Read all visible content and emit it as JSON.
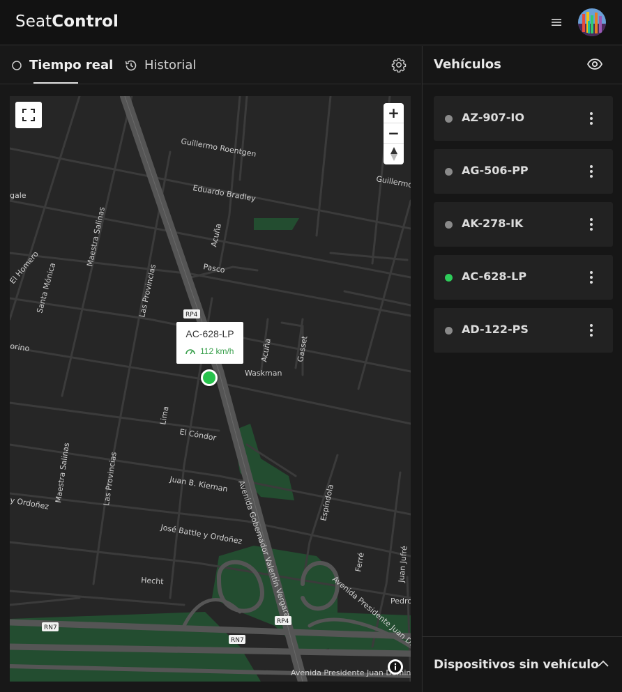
{
  "app": {
    "brand_light": "Seat",
    "brand_bold": "Control"
  },
  "tabs": {
    "live": "Tiempo real",
    "history": "Historial"
  },
  "sidebar": {
    "title": "Vehículos",
    "vehicles": [
      {
        "plate": "AZ-907-IO",
        "status": "inactive"
      },
      {
        "plate": "AG-506-PP",
        "status": "inactive"
      },
      {
        "plate": "AK-278-IK",
        "status": "inactive"
      },
      {
        "plate": "AC-628-LP",
        "status": "active"
      },
      {
        "plate": "AD-122-PS",
        "status": "inactive"
      }
    ],
    "devices_label": "Dispositivos sin vehículo"
  },
  "map": {
    "popup": {
      "plate": "AC-628-LP",
      "speed": "112 km/h"
    },
    "zoom_in": "+",
    "zoom_out": "−",
    "streets": {
      "s1": "Guillermo Roentgen",
      "s2": "Guillermo",
      "s3": "Eduardo Bradley",
      "s4": "gale",
      "s5": "Maestra Salinas",
      "s6": "Acuña",
      "s7": "El Homero",
      "s8": "Santa Mónica",
      "s9": "Las Provincias",
      "s10": "Pasco",
      "s11": "Acuña",
      "s12": "Gasset",
      "s13": "orino",
      "s14": "Waskman",
      "s15": "Lima",
      "s16": "El Cóndor",
      "s17": "Maestra Salinas",
      "s18": "Las Provincias",
      "s19": "Juan B. Kiernan",
      "s20": "y Ordoñez",
      "s21": "Avenida Gobernador Valentín Vergara",
      "s22": "Espíndola",
      "s23": "José Battle y Ordoñez",
      "s24": "Ferré",
      "s25": "Juan Jufré",
      "s26": "Hecht",
      "s27": "Avenida Presidente Juan Do",
      "s28": "Pedro",
      "s29": "Avenida Presidente Juan Domingo"
    },
    "shields": {
      "rp4a": "RP4",
      "rp4b": "RP4",
      "rn7a": "RN7",
      "rn7b": "RN7"
    }
  },
  "colors": {
    "accent_green": "#2ecc5a",
    "inactive_dot": "#8a8a8a",
    "park_green": "#234d30"
  }
}
